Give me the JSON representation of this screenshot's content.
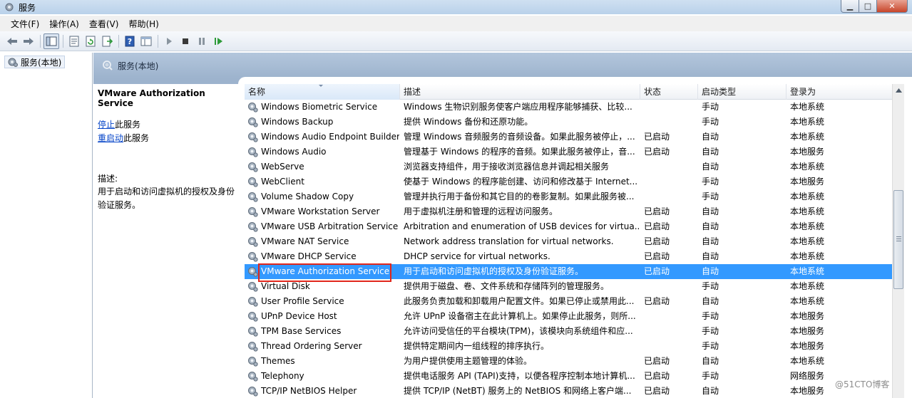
{
  "window": {
    "title": "服务"
  },
  "menu": [
    "文件(F)",
    "操作(A)",
    "查看(V)",
    "帮助(H)"
  ],
  "toolbar": {
    "icons": [
      "back-icon",
      "forward-icon",
      "show-tree-icon",
      "properties-icon",
      "refresh-icon",
      "export-icon",
      "help-icon",
      "view-icon",
      "start-icon",
      "stop-icon",
      "pause-icon",
      "restart-icon"
    ]
  },
  "tree": {
    "item": "服务(本地)"
  },
  "panel": {
    "header": "服务(本地)"
  },
  "desc": {
    "title": "VMware Authorization Service",
    "stop_link": "停止",
    "stop_suffix": "此服务",
    "restart_link": "重启动",
    "restart_suffix": "此服务",
    "label": "描述:",
    "body": "用于启动和访问虚拟机的授权及身份验证服务。"
  },
  "table": {
    "columns": [
      "名称",
      "描述",
      "状态",
      "启动类型",
      "登录为"
    ],
    "rows": [
      {
        "name": "Windows Biometric Service",
        "desc": "Windows 生物识别服务使客户端应用程序能够捕获、比较...",
        "status": "",
        "startup": "手动",
        "logon": "本地系统"
      },
      {
        "name": "Windows Backup",
        "desc": "提供 Windows 备份和还原功能。",
        "status": "",
        "startup": "手动",
        "logon": "本地系统"
      },
      {
        "name": "Windows Audio Endpoint Builder",
        "desc": "管理 Windows 音频服务的音频设备。如果此服务被停止，...",
        "status": "已启动",
        "startup": "自动",
        "logon": "本地系统"
      },
      {
        "name": "Windows Audio",
        "desc": "管理基于 Windows 的程序的音频。如果此服务被停止，音...",
        "status": "已启动",
        "startup": "自动",
        "logon": "本地服务"
      },
      {
        "name": "WebServe",
        "desc": "浏览器支持组件，用于接收浏览器信息并调起相关服务",
        "status": "",
        "startup": "自动",
        "logon": "本地系统"
      },
      {
        "name": "WebClient",
        "desc": "使基于 Windows 的程序能创建、访问和修改基于 Internet...",
        "status": "",
        "startup": "手动",
        "logon": "本地服务"
      },
      {
        "name": "Volume Shadow Copy",
        "desc": "管理并执行用于备份和其它目的的卷影复制。如果此服务被...",
        "status": "",
        "startup": "手动",
        "logon": "本地系统"
      },
      {
        "name": "VMware Workstation Server",
        "desc": "用于虚拟机注册和管理的远程访问服务。",
        "status": "已启动",
        "startup": "自动",
        "logon": "本地系统"
      },
      {
        "name": "VMware USB Arbitration Service",
        "desc": "Arbitration and enumeration of USB devices for virtua...",
        "status": "已启动",
        "startup": "自动",
        "logon": "本地系统"
      },
      {
        "name": "VMware NAT Service",
        "desc": "Network address translation for virtual networks.",
        "status": "已启动",
        "startup": "自动",
        "logon": "本地系统"
      },
      {
        "name": "VMware DHCP Service",
        "desc": "DHCP service for virtual networks.",
        "status": "已启动",
        "startup": "自动",
        "logon": "本地系统"
      },
      {
        "name": "VMware Authorization Service",
        "desc": "用于启动和访问虚拟机的授权及身份验证服务。",
        "status": "已启动",
        "startup": "自动",
        "logon": "本地系统"
      },
      {
        "name": "Virtual Disk",
        "desc": "提供用于磁盘、卷、文件系统和存储阵列的管理服务。",
        "status": "",
        "startup": "手动",
        "logon": "本地系统"
      },
      {
        "name": "User Profile Service",
        "desc": "此服务负责加载和卸载用户配置文件。如果已停止或禁用此...",
        "status": "已启动",
        "startup": "自动",
        "logon": "本地系统"
      },
      {
        "name": "UPnP Device Host",
        "desc": "允许 UPnP 设备宿主在此计算机上。如果停止此服务，则所...",
        "status": "",
        "startup": "手动",
        "logon": "本地服务"
      },
      {
        "name": "TPM Base Services",
        "desc": "允许访问受信任的平台模块(TPM)，该模块向系统组件和应...",
        "status": "",
        "startup": "手动",
        "logon": "本地服务"
      },
      {
        "name": "Thread Ordering Server",
        "desc": "提供特定期间内一组线程的排序执行。",
        "status": "",
        "startup": "手动",
        "logon": "本地服务"
      },
      {
        "name": "Themes",
        "desc": "为用户提供使用主题管理的体验。",
        "status": "已启动",
        "startup": "自动",
        "logon": "本地系统"
      },
      {
        "name": "Telephony",
        "desc": "提供电话服务 API (TAPI)支持，以便各程序控制本地计算机...",
        "status": "已启动",
        "startup": "手动",
        "logon": "网络服务"
      },
      {
        "name": "TCP/IP NetBIOS Helper",
        "desc": "提供 TCP/IP (NetBT) 服务上的 NetBIOS 和网络上客户端...",
        "status": "已启动",
        "startup": "自动",
        "logon": "本地服务"
      }
    ],
    "selected_index": 11
  },
  "watermark": "@51CTO博客",
  "colors": {
    "selection": "#3399ff",
    "highlight_box": "#e0261c",
    "link": "#0645c8"
  }
}
